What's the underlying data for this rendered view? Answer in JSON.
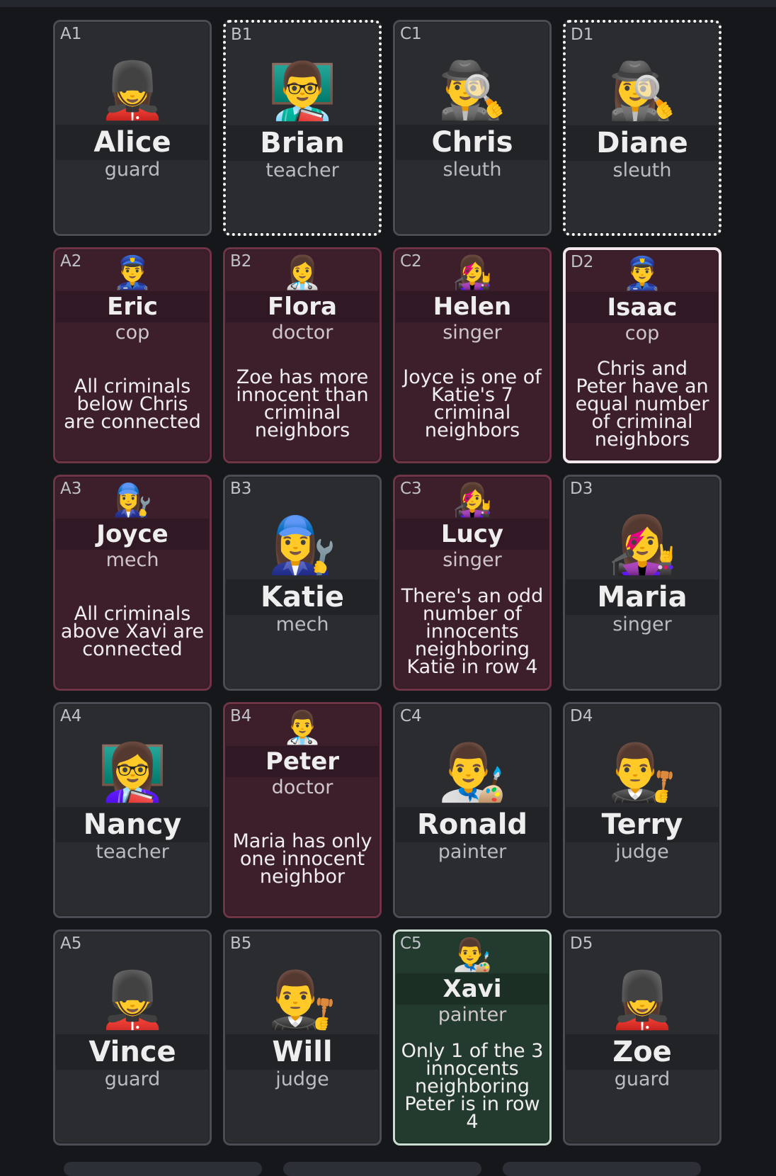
{
  "cards": [
    {
      "coord": "A1",
      "name": "Alice",
      "role": "guard",
      "emoji": "💂‍♀️",
      "state": "unknown",
      "hint": ""
    },
    {
      "coord": "B1",
      "name": "Brian",
      "role": "teacher",
      "emoji": "👨‍🏫",
      "state": "unknown",
      "hint": ""
    },
    {
      "coord": "C1",
      "name": "Chris",
      "role": "sleuth",
      "emoji": "🕵️‍♂️",
      "state": "unknown",
      "hint": ""
    },
    {
      "coord": "D1",
      "name": "Diane",
      "role": "sleuth",
      "emoji": "🕵️‍♀️",
      "state": "unknown",
      "hint": ""
    },
    {
      "coord": "A2",
      "name": "Eric",
      "role": "cop",
      "emoji": "👮‍♂️",
      "state": "criminal",
      "hint": "All criminals below Chris are connected"
    },
    {
      "coord": "B2",
      "name": "Flora",
      "role": "doctor",
      "emoji": "👩‍⚕️",
      "state": "criminal",
      "hint": "Zoe has more innocent than criminal neighbors"
    },
    {
      "coord": "C2",
      "name": "Helen",
      "role": "singer",
      "emoji": "👩‍🎤",
      "state": "criminal",
      "hint": "Joyce is one of Katie's 7 criminal neighbors"
    },
    {
      "coord": "D2",
      "name": "Isaac",
      "role": "cop",
      "emoji": "👮‍♂️",
      "state": "criminal",
      "hint": "Chris and Peter have an equal number of criminal neighbors"
    },
    {
      "coord": "A3",
      "name": "Joyce",
      "role": "mech",
      "emoji": "👩‍🔧",
      "state": "criminal",
      "hint": "All criminals above Xavi are connected"
    },
    {
      "coord": "B3",
      "name": "Katie",
      "role": "mech",
      "emoji": "👩‍🔧",
      "state": "unknown",
      "hint": ""
    },
    {
      "coord": "C3",
      "name": "Lucy",
      "role": "singer",
      "emoji": "👩‍🎤",
      "state": "criminal",
      "hint": "There's an odd number of innocents neighboring Katie in row 4"
    },
    {
      "coord": "D3",
      "name": "Maria",
      "role": "singer",
      "emoji": "👩‍🎤",
      "state": "unknown",
      "hint": ""
    },
    {
      "coord": "A4",
      "name": "Nancy",
      "role": "teacher",
      "emoji": "👩‍🏫",
      "state": "unknown",
      "hint": ""
    },
    {
      "coord": "B4",
      "name": "Peter",
      "role": "doctor",
      "emoji": "👨‍⚕️",
      "state": "criminal",
      "hint": "Maria has only one innocent neighbor"
    },
    {
      "coord": "C4",
      "name": "Ronald",
      "role": "painter",
      "emoji": "👨‍🎨",
      "state": "unknown",
      "hint": ""
    },
    {
      "coord": "D4",
      "name": "Terry",
      "role": "judge",
      "emoji": "👨‍⚖️",
      "state": "unknown",
      "hint": ""
    },
    {
      "coord": "A5",
      "name": "Vince",
      "role": "guard",
      "emoji": "💂‍♂️",
      "state": "unknown",
      "hint": ""
    },
    {
      "coord": "B5",
      "name": "Will",
      "role": "judge",
      "emoji": "👨‍⚖️",
      "state": "unknown",
      "hint": ""
    },
    {
      "coord": "C5",
      "name": "Xavi",
      "role": "painter",
      "emoji": "👨‍🎨",
      "state": "innocent",
      "hint": "Only 1 of the 3 innocents neighboring Peter is in row 4"
    },
    {
      "coord": "D5",
      "name": "Zoe",
      "role": "guard",
      "emoji": "💂‍♀️",
      "state": "unknown",
      "hint": ""
    }
  ],
  "highlight": {
    "dotted": [
      "B1",
      "D1"
    ],
    "selected": [
      "D2"
    ]
  },
  "colors": {
    "criminal": "#3d1f2c",
    "innocent": "#233a2e",
    "unknown": "#2a2c30"
  }
}
